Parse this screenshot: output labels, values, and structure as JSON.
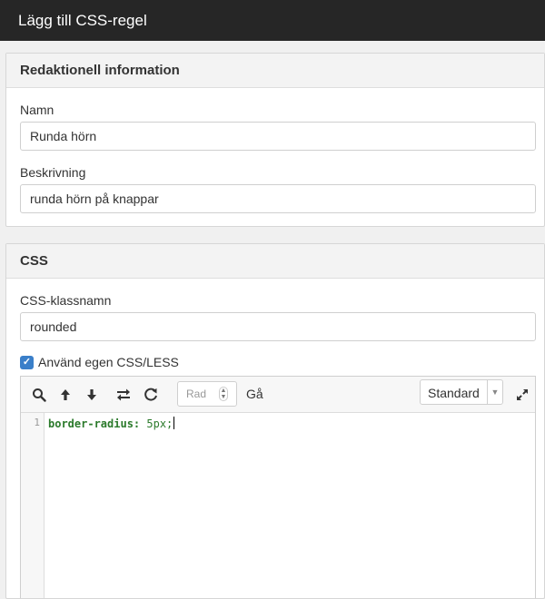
{
  "window": {
    "title": "Lägg till CSS-regel"
  },
  "editorial": {
    "heading": "Redaktionell information",
    "name_label": "Namn",
    "name_value": "Runda hörn",
    "description_label": "Beskrivning",
    "description_value": "runda hörn på knappar"
  },
  "css": {
    "heading": "CSS",
    "classname_label": "CSS-klassnamn",
    "classname_value": "rounded",
    "custom_checkbox_label": "Använd egen CSS/LESS",
    "custom_checkbox_checked": true,
    "toolbar": {
      "icons": [
        "search-icon",
        "arrow-up-icon",
        "arrow-down-icon",
        "swap-icon",
        "refresh-icon",
        "fullscreen-icon"
      ],
      "row_placeholder": "Rad",
      "go_label": "Gå",
      "mode_value": "Standard"
    },
    "code": {
      "line_number": "1",
      "property": "border-radius:",
      "value": " 5px;"
    }
  },
  "colors": {
    "titlebar": "#262626",
    "checkbox": "#3a7fc9",
    "code": "#2b7a2b"
  }
}
